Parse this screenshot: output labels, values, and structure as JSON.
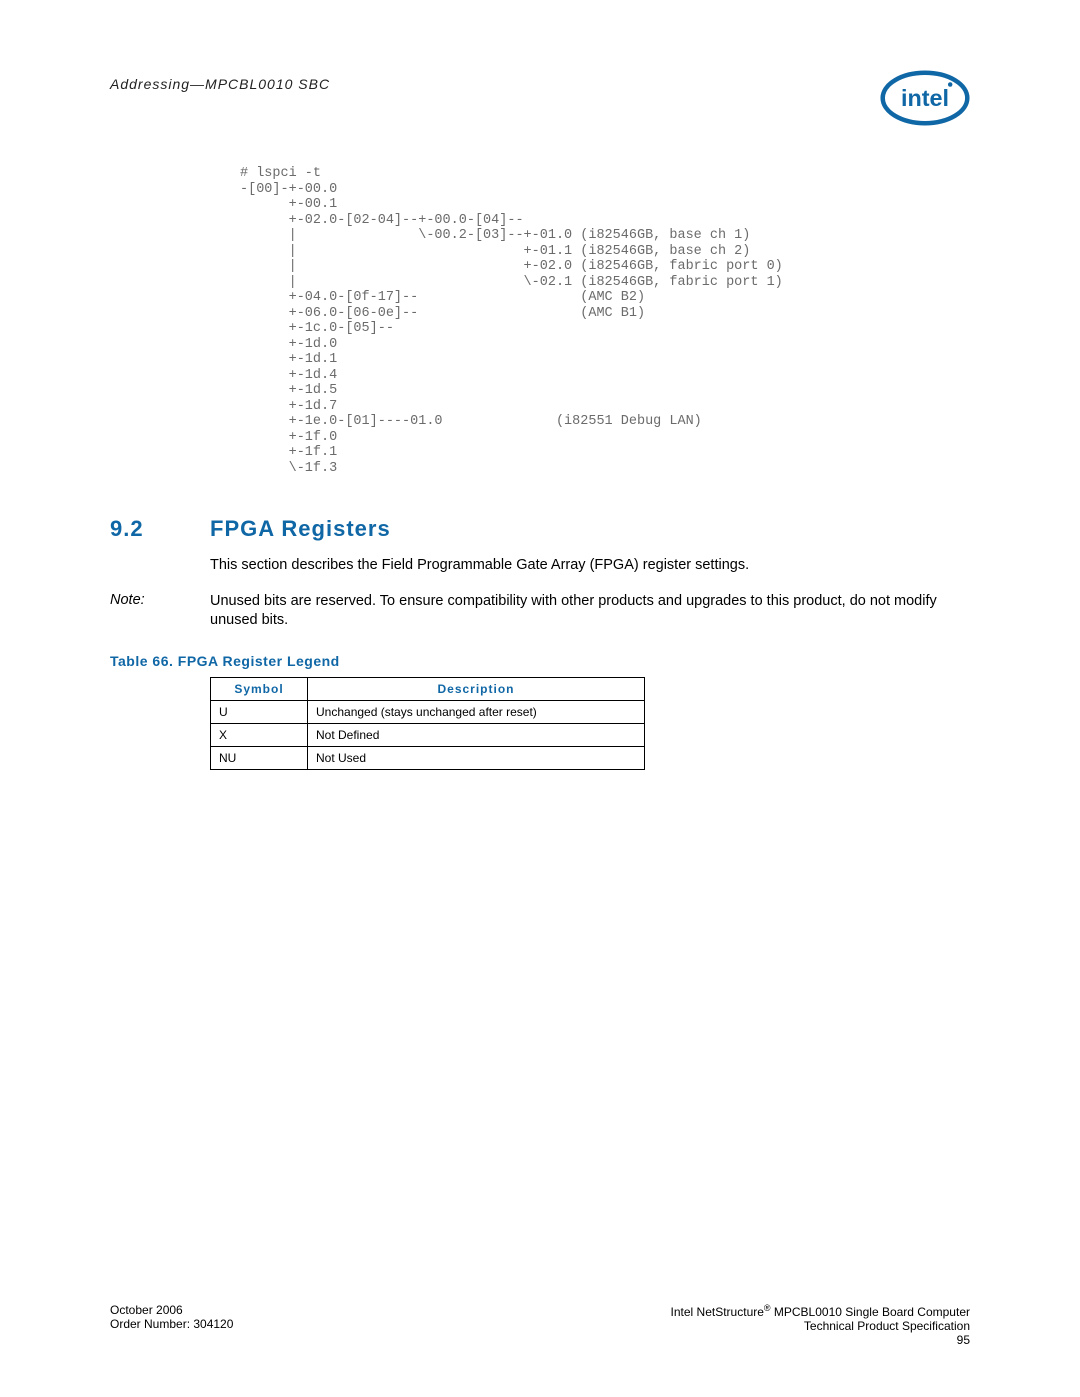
{
  "header": {
    "running_head": "Addressing—MPCBL0010 SBC",
    "logo_name": "intel"
  },
  "code": "# lspci -t\n-[00]-+-00.0\n      +-00.1\n      +-02.0-[02-04]--+-00.0-[04]--\n      |               \\-00.2-[03]--+-01.0 (i82546GB, base ch 1)\n      |                            +-01.1 (i82546GB, base ch 2)\n      |                            +-02.0 (i82546GB, fabric port 0)\n      |                            \\-02.1 (i82546GB, fabric port 1)\n      +-04.0-[0f-17]--                    (AMC B2)\n      +-06.0-[06-0e]--                    (AMC B1)\n      +-1c.0-[05]--\n      +-1d.0\n      +-1d.1\n      +-1d.4\n      +-1d.5\n      +-1d.7\n      +-1e.0-[01]----01.0              (i82551 Debug LAN)\n      +-1f.0\n      +-1f.1\n      \\-1f.3",
  "section": {
    "number": "9.2",
    "title": "FPGA Registers",
    "intro": "This section describes the Field Programmable Gate Array (FPGA) register settings.",
    "note_label": "Note:",
    "note_text": "Unused bits are reserved. To ensure compatibility with other products and upgrades to this product, do not modify unused bits."
  },
  "table": {
    "caption": "Table 66.   FPGA Register Legend",
    "headers": {
      "symbol": "Symbol",
      "description": "Description"
    },
    "rows": [
      {
        "symbol": "U",
        "description": "Unchanged (stays unchanged after reset)"
      },
      {
        "symbol": "X",
        "description": "Not Defined"
      },
      {
        "symbol": "NU",
        "description": "Not Used"
      }
    ]
  },
  "footer": {
    "left_line1": "October 2006",
    "left_line2": "Order Number: 304120",
    "right_line1_a": "Intel NetStructure",
    "right_line1_b": " MPCBL0010 Single Board Computer",
    "right_line2": "Technical Product Specification",
    "right_line3": "95"
  }
}
